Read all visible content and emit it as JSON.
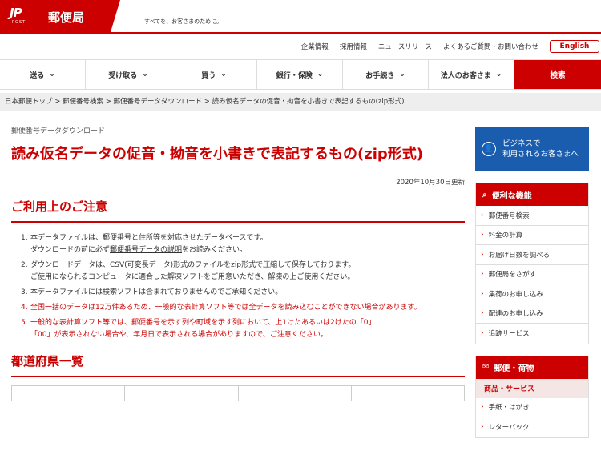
{
  "header": {
    "logo_mark": "JP",
    "logo_post": "POST",
    "brand": "郵便局",
    "tagline": "すべてを、お客さまのために。"
  },
  "utility_links": [
    "企業情報",
    "採用情報",
    "ニュースリリース",
    "よくあるご質問・お問い合わせ"
  ],
  "english_label": "English",
  "nav": {
    "items": [
      "送る",
      "受け取る",
      "買う",
      "銀行・保険",
      "お手続き",
      "法人のお客さま"
    ],
    "search_label": "検索"
  },
  "breadcrumb": "日本郵便トップ > 郵便番号検索 > 郵便番号データダウンロード > 読み仮名データの促音・拗音を小書きで表記するもの(zip形式)",
  "main": {
    "eyebrow": "郵便番号データダウンロード",
    "title": "読み仮名データの促音・拗音を小書きで表記するもの(zip形式)",
    "updated": "2020年10月30日更新",
    "notice_heading": "ご利用上のご注意",
    "notes": [
      {
        "num": "1.",
        "line1": "本データファイルは、郵便番号と住所等を対応させたデータベースです。",
        "line2_pre": "ダウンロードの前に必ず",
        "line2_link": "郵便番号データの説明",
        "line2_post": "をお読みください。"
      },
      {
        "num": "2.",
        "line1": "ダウンロードデータは、CSV(可変長データ)形式のファイルをzip形式で圧縮して保存しております。",
        "line2": "ご使用になられるコンピュータに適合した解凍ソフトをご用意いただき、解凍の上ご使用ください。"
      },
      {
        "num": "3.",
        "line1": "本データファイルには検索ソフトは含まれておりませんのでご承知ください。"
      },
      {
        "num": "4.",
        "line1": "全国一括のデータは12万件あるため、一般的な表計算ソフト等では全データを読み込むことができない場合があります。"
      },
      {
        "num": "5.",
        "line1": "一般的な表計算ソフト等では、郵便番号を示す列や町域を示す列において、上1けたあるいは2けたの「0」",
        "line2": "「00」が表示されない場合や、年月日で表示される場合がありますので、ご注意ください。"
      }
    ],
    "prefecture_heading": "都道府県一覧"
  },
  "sidebar": {
    "business_line1": "ビジネスで",
    "business_line2": "利用されるお客さまへ",
    "features_heading": "便利な機能",
    "features": [
      "郵便番号検索",
      "料金の計算",
      "お届け日数を調べる",
      "郵便局をさがす",
      "集荷のお申し込み",
      "配達のお申し込み",
      "追跡サービス"
    ],
    "mail_heading": "郵便・荷物",
    "mail_sub": "商品・サービス",
    "mail_items": [
      "手紙・はがき",
      "レターパック"
    ]
  },
  "colors": {
    "brand_red": "#cc0000",
    "business_blue": "#1a5cae"
  }
}
